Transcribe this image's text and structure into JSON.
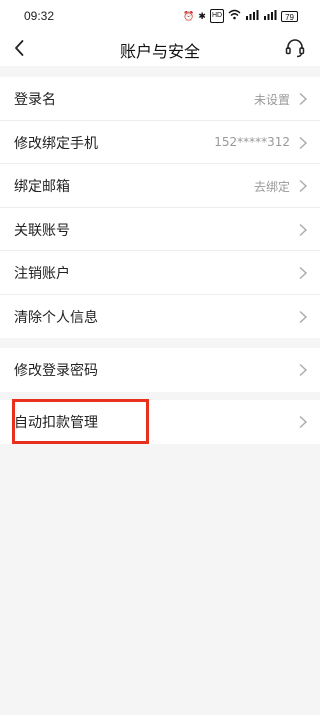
{
  "status": {
    "time": "09:32",
    "icons": [
      "alarm-icon",
      "bluetooth-icon",
      "hd-icon",
      "wifi-icon",
      "signal-icon",
      "signal-icon"
    ],
    "signal1": "5G",
    "signal2": "4G",
    "battery": "79"
  },
  "nav": {
    "title": "账户与安全"
  },
  "section1": [
    {
      "label": "登录名",
      "value": "未设置"
    },
    {
      "label": "修改绑定手机",
      "value": "152*****312"
    },
    {
      "label": "绑定邮箱",
      "value": "去绑定"
    },
    {
      "label": "关联账号",
      "value": ""
    },
    {
      "label": "注销账户",
      "value": ""
    },
    {
      "label": "清除个人信息",
      "value": ""
    }
  ],
  "section2": [
    {
      "label": "修改登录密码",
      "value": ""
    }
  ],
  "section3": [
    {
      "label": "自动扣款管理",
      "value": ""
    }
  ],
  "colors": {
    "highlight": "#e8301f",
    "background": "#f5f5f5"
  }
}
